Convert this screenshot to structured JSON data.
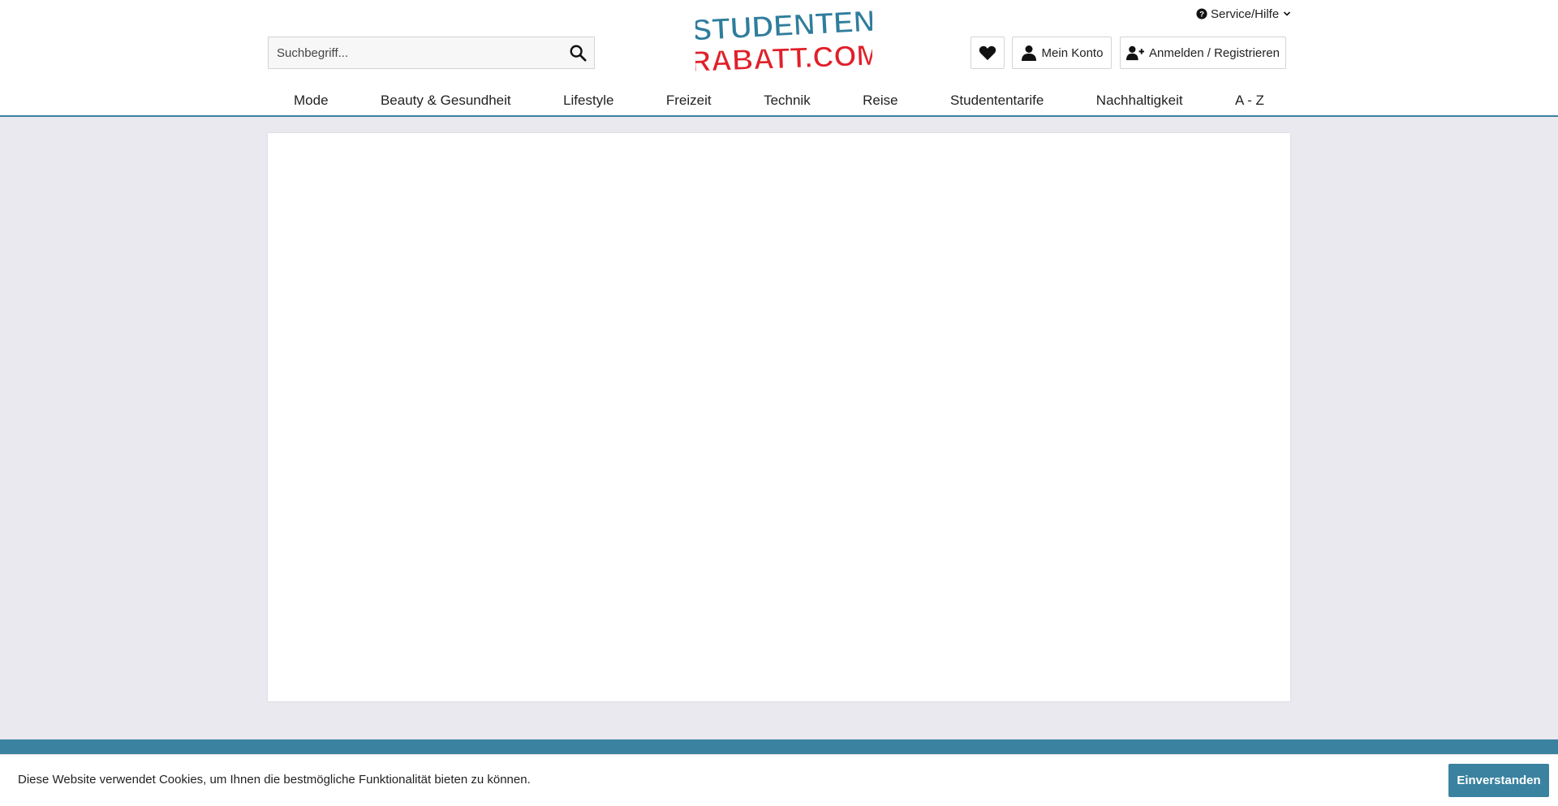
{
  "search": {
    "placeholder": "Suchbegriff..."
  },
  "logo": {
    "line1": "STUDENTEN",
    "line2": "RABATT.COM"
  },
  "service": {
    "label": "Service/Hilfe"
  },
  "header_buttons": {
    "account_label": "Mein Konto",
    "login_label": "Anmelden / Registrieren"
  },
  "nav": {
    "items": [
      "Mode",
      "Beauty & Gesundheit",
      "Lifestyle",
      "Freizeit",
      "Technik",
      "Reise",
      "Studententarife",
      "Nachhaltigkeit",
      "A - Z"
    ]
  },
  "cookie": {
    "text": "Diese Website verwendet Cookies, um Ihnen die bestmögliche Funktionalität bieten zu können.",
    "accept_label": "Einverstanden"
  },
  "colors": {
    "accent": "#3a82a0",
    "logo_blue": "#2f7d9c",
    "logo_red": "#e0202a",
    "page_bg": "#e9e9ef"
  },
  "icons": {
    "search": "search-icon",
    "help": "help-circle-icon",
    "chevron": "chevron-down-icon",
    "wishlist": "heart-icon",
    "account": "user-icon",
    "register": "user-plus-icon"
  }
}
